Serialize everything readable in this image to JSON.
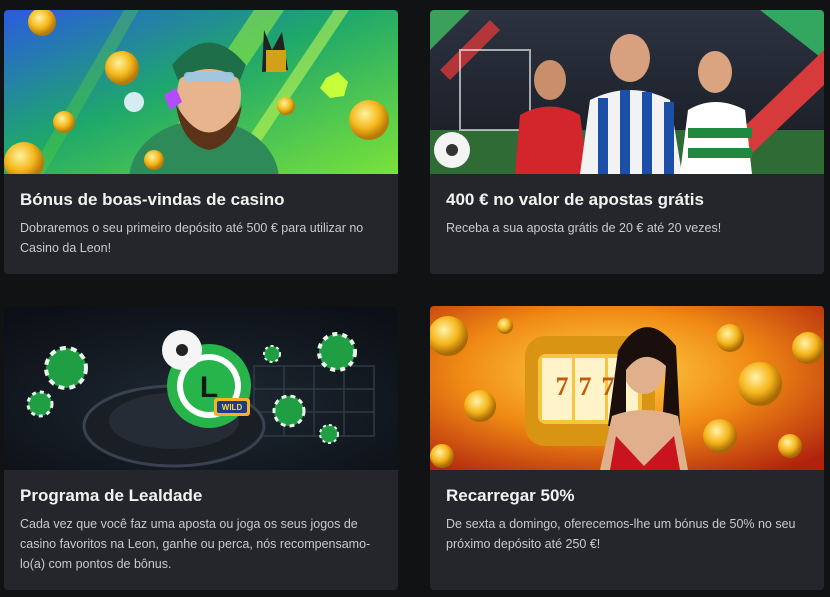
{
  "promotions": [
    {
      "title": "Bónus de boas-vindas de casino",
      "description": "Dobraremos o seu primeiro depósito até 500 € para utilizar no Casino da Leon!",
      "banner_icon": "casino-explorer-banner-icon"
    },
    {
      "title": "400 € no valor de apostas grátis",
      "description": "Receba a sua aposta grátis de 20 € até 20 vezes!",
      "banner_icon": "football-players-banner-icon"
    },
    {
      "title": "Programa de Lealdade",
      "description": "Cada vez que você faz uma aposta ou joga os seus jogos de casino favoritos na Leon, ganhe ou perca, nós recompensamo-lo(a) com pontos de bônus.",
      "banner_icon": "loyalty-chips-banner-icon",
      "banner_text": "WILD"
    },
    {
      "title": "Recarregar 50%",
      "description": "De sexta a domingo, oferecemos-lhe um bónus de 50% no seu próximo depósito até 250 €!",
      "banner_icon": "slot-coins-banner-icon",
      "banner_text": "777"
    }
  ],
  "colors": {
    "page_background": "#111214",
    "card_background": "#25262b",
    "title_text": "#f2f2f2",
    "description_text": "#c9cacd",
    "accent_green": "#5fd13a"
  }
}
